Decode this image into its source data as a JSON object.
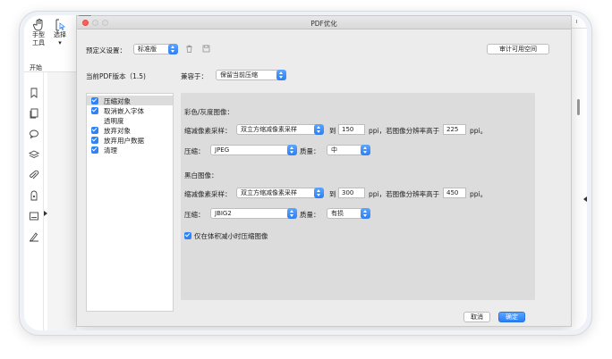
{
  "host_app": {
    "tools": [
      {
        "icon": "hand-icon",
        "label_line1": "手型",
        "label_line2": "工具"
      },
      {
        "icon": "select-cursor-icon",
        "label_line1": "选择",
        "label_line2": "▾"
      }
    ],
    "section_label": "开始",
    "side_icons": [
      "bookmark-icon",
      "page-thumbnail-icon",
      "comment-icon",
      "layers-icon",
      "attachment-icon",
      "security-lock-icon",
      "form-field-icon",
      "signature-icon"
    ]
  },
  "dialog": {
    "title": "PDF优化",
    "preset": {
      "label": "预定义设置：",
      "value": "标准版"
    },
    "audit_button": "审计可用空间",
    "version_label": "当前PDF版本（1.5)",
    "compat": {
      "label": "兼容于：",
      "value": "保留当前压缩"
    },
    "categories": [
      {
        "label": "压缩对象",
        "checked": true,
        "selected": true
      },
      {
        "label": "取消嵌入字体",
        "checked": true,
        "selected": false
      },
      {
        "label": "透明度",
        "checked": false,
        "selected": false
      },
      {
        "label": "放弃对象",
        "checked": true,
        "selected": false
      },
      {
        "label": "放弃用户数据",
        "checked": true,
        "selected": false
      },
      {
        "label": "清理",
        "checked": true,
        "selected": false
      }
    ],
    "color_section": {
      "title": "彩色/灰度图像：",
      "downsample_label": "缩减像素采样：",
      "downsample_value": "双立方缩减像素采样",
      "to_label": "到",
      "to_value": "150",
      "ppi_label": "ppi，若图像分辨率高于",
      "above_value": "225",
      "ppi_end": "ppi。",
      "compression_label": "压缩：",
      "compression_value": "JPEG",
      "quality_label": "质量：",
      "quality_value": "中"
    },
    "mono_section": {
      "title": "黑白图像：",
      "downsample_label": "缩减像素采样：",
      "downsample_value": "双立方缩减像素采样",
      "to_label": "到",
      "to_value": "300",
      "ppi_label": "ppi，若图像分辨率高于",
      "above_value": "450",
      "ppi_end": "ppi。",
      "compression_label": "压缩：",
      "compression_value": "JBIG2",
      "quality_label": "质量：",
      "quality_value": "有损"
    },
    "only_smaller": {
      "label": "仅在体积减小时压缩图像",
      "checked": true
    },
    "cancel_button": "取消",
    "ok_button": "确定"
  },
  "colors": {
    "accent": "#2f83f7",
    "close_button": "#fc605c"
  }
}
